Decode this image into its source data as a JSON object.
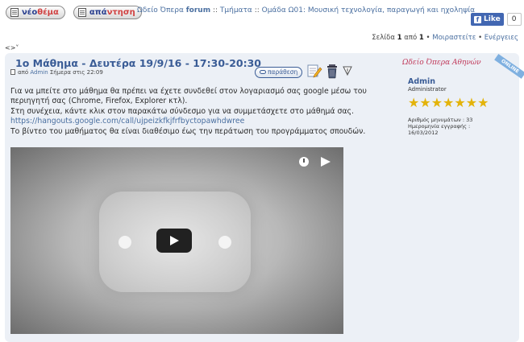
{
  "toolbar": {
    "new_topic": {
      "first": "νέο",
      "rest": "θέμα"
    },
    "reply": {
      "first": "απά",
      "rest": "ντηση"
    }
  },
  "breadcrumb": {
    "forum_prefix": "Ωδείο Όπερα ",
    "forum_bold": "forum",
    "sep1": " :: ",
    "section": "Τμήματα",
    "sep2": " :: ",
    "group": "Ομάδα Ω01: Μουσική τεχνολογία, παραγωγή και ηχοληψία"
  },
  "facebook": {
    "like_label": "Like",
    "count": "0"
  },
  "pagination": {
    "page_word": "Σελίδα ",
    "current": "1",
    "of_word": " από ",
    "total": "1",
    "bullet": " • ",
    "share": "Μοιραστείτε",
    "actions": "Ενέργειες"
  },
  "arrows": "<>",
  "post": {
    "title": "1ο Μάθημα - Δευτέρα 19/9/16 - 17:30-20:30",
    "meta_from": "από ",
    "author": "Admin",
    "meta_time": " Σήμερα στις 22:09",
    "quote_label": "παράθεση",
    "body_line1": "Για να μπείτε στο μάθημα θα πρέπει να έχετε συνδεθεί στον λογαριασμό σας google μέσω του",
    "body_line2": "περιηγητή σας (Chrome, Firefox, Explorer κτλ).",
    "body_line3": "Στη συνέχεια, κάντε κλικ στον παρακάτω σύνδεσμο για να συμμετάσχετε στο μάθημά σας.",
    "link": "https://hangouts.google.com/call/ujpeizkfkjfrfbyctopawhdwree",
    "body_line5": "Το βίντεο του μαθήματος θα είναι διαθέσιμο έως την περάτωση του προγράμματος σπουδών."
  },
  "profile": {
    "logo_text": "Ωδείο Όπερα Αθηνών",
    "status": "ONLINE",
    "name": "Admin",
    "role": "Administrator",
    "stars": "★★★★★★★",
    "messages": "Αριθμός μηνυμάτων : 33",
    "reg_label": "Ημερομηνία εγγραφής :",
    "reg_date": "16/03/2012"
  },
  "colors": {
    "accent": "#3a5c96",
    "link": "#4a6fa0",
    "post_bg": "#ecf0f6",
    "star": "#e3b30a"
  }
}
